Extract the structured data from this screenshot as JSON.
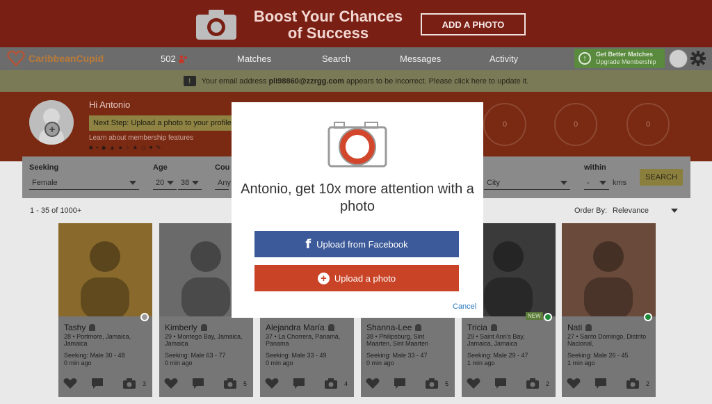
{
  "banner": {
    "title": "Boost Your Chances of Success",
    "button": "ADD A PHOTO"
  },
  "nav": {
    "logo": "CaribbeanCupid",
    "count": "502",
    "items": [
      "Matches",
      "Search",
      "Messages",
      "Activity"
    ],
    "upgrade_title": "Get Better Matches",
    "upgrade_sub": "Upgrade Membership"
  },
  "notice": {
    "pre": "Your email address",
    "email": "pli98860@zzrgg.com",
    "post": "appears to be incorrect. Please click here to update it."
  },
  "hero": {
    "greeting": "Hi Antonio",
    "next_step": "Next Step: Upload a photo to your profile",
    "learn": "Learn about membership features",
    "stats": [
      "0",
      "0",
      "0"
    ]
  },
  "filters": {
    "seeking_label": "Seeking",
    "seeking_value": "Female",
    "age_label": "Age",
    "age_min": "20",
    "age_max": "38",
    "country_label": "Cou",
    "country_value": "Any",
    "city_value": "City",
    "within_label": "within",
    "within_value": "-",
    "within_unit": "kms",
    "search_button": "SEARCH"
  },
  "results": {
    "count": "1 - 35 of 1000+",
    "order_label": "Order By:",
    "order_value": "Relevance"
  },
  "cards": [
    {
      "name": "Tashy",
      "location": "28 • Portmore, Jamaica, Jamaica",
      "seeking": "Seeking: Male 30 - 48",
      "time": "0 min ago",
      "photos": "3",
      "status": "#9a9a9a",
      "badge": ""
    },
    {
      "name": "Kimberly",
      "location": "29 • Montego Bay, Jamaica, Jamaica",
      "seeking": "Seeking: Male 63 - 77",
      "time": "0 min ago",
      "photos": "5",
      "status": "",
      "badge": ""
    },
    {
      "name": "Alejandra María",
      "location": "37 • La Chorrera, Panamá, Panama",
      "seeking": "Seeking: Male 33 - 49",
      "time": "0 min ago",
      "photos": "4",
      "status": "",
      "badge": ""
    },
    {
      "name": "Shanna-Lee",
      "location": "38 • Philipsburg, Sint Maarten, Sint Maarten",
      "seeking": "Seeking: Male 33 - 47",
      "time": "0 min ago",
      "photos": "5",
      "status": "",
      "badge": ""
    },
    {
      "name": "Tricia",
      "location": "29 • Saint Ann's Bay, Jamaica, Jamaica",
      "seeking": "Seeking: Male 29 - 47",
      "time": "1 min ago",
      "photos": "2",
      "status": "#1f8a3a",
      "badge": "NEW"
    },
    {
      "name": "Nati",
      "location": "27 • Santo Domingo, Distrito Nacional,",
      "seeking": "Seeking: Male 26 - 45",
      "time": "1 min ago",
      "photos": "2",
      "status": "#1f8a3a",
      "badge": ""
    }
  ],
  "modal": {
    "title": "Antonio, get 10x more attention with a photo",
    "facebook_button": "Upload from Facebook",
    "upload_button": "Upload a photo",
    "cancel": "Cancel"
  }
}
